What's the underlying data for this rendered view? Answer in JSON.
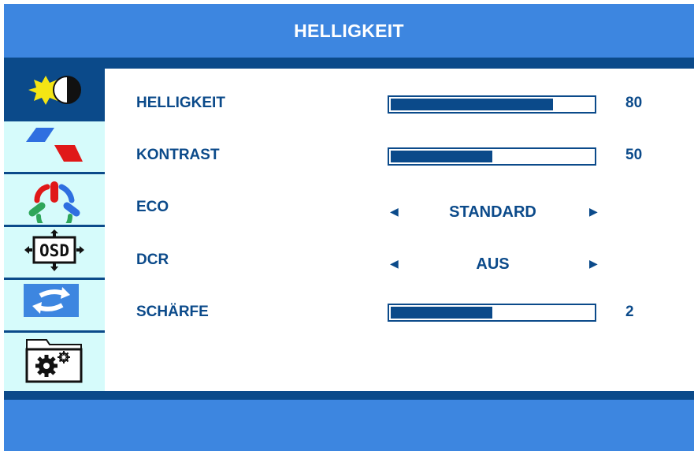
{
  "header": {
    "title": "HELLIGKEIT"
  },
  "sidebar": {
    "tabs": [
      {
        "icon": "brightness-icon",
        "active": true
      },
      {
        "icon": "image-icon",
        "active": false
      },
      {
        "icon": "color-icon",
        "active": false
      },
      {
        "icon": "osd-icon",
        "active": false,
        "text": "OSD"
      },
      {
        "icon": "reset-icon",
        "active": false
      },
      {
        "icon": "settings-icon",
        "active": false
      }
    ]
  },
  "settings": {
    "brightness": {
      "label": "HELLIGKEIT",
      "value": "80",
      "level": 0.8
    },
    "contrast": {
      "label": "KONTRAST",
      "value": "50",
      "level": 0.5
    },
    "eco": {
      "label": "ECO",
      "selected": "STANDARD"
    },
    "dcr": {
      "label": "DCR",
      "selected": "AUS"
    },
    "sharpness": {
      "label": "SCHÄRFE",
      "value": "2",
      "level": 0.5
    }
  },
  "colors": {
    "header_blue": "#3d86e0",
    "navy": "#0b4a8a",
    "sidebar_bg": "#d6fbfb"
  }
}
